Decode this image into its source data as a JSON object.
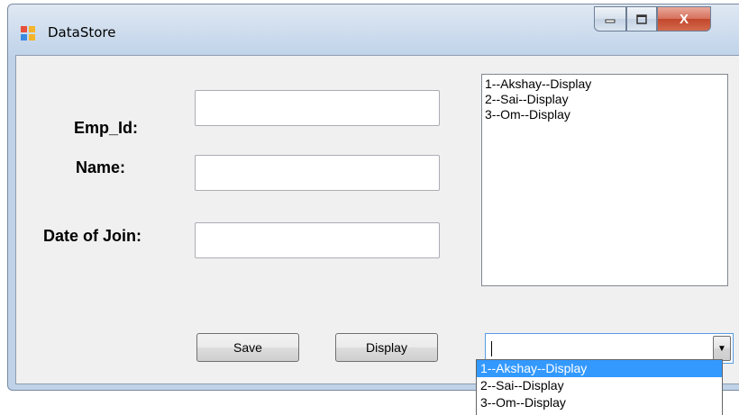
{
  "window": {
    "title": "DataStore",
    "min_icon": "minimize-icon",
    "max_icon": "maximize-icon",
    "close_glyph": "X"
  },
  "form": {
    "emp_id_label": "Emp_Id:",
    "name_label": "Name:",
    "doj_label": "Date of Join:",
    "emp_id_value": "",
    "name_value": "",
    "doj_value": ""
  },
  "listbox": {
    "items": [
      "1--Akshay--Display",
      "2--Sai--Display",
      "3--Om--Display"
    ]
  },
  "buttons": {
    "save_label": "Save",
    "display_label": "Display"
  },
  "combo": {
    "value": "",
    "options": [
      "1--Akshay--Display",
      "2--Sai--Display",
      "3--Om--Display"
    ],
    "highlighted_index": 0
  },
  "colors": {
    "highlight": "#3399ff",
    "close_button": "#c2472c",
    "client_bg": "#f0f0f0"
  }
}
